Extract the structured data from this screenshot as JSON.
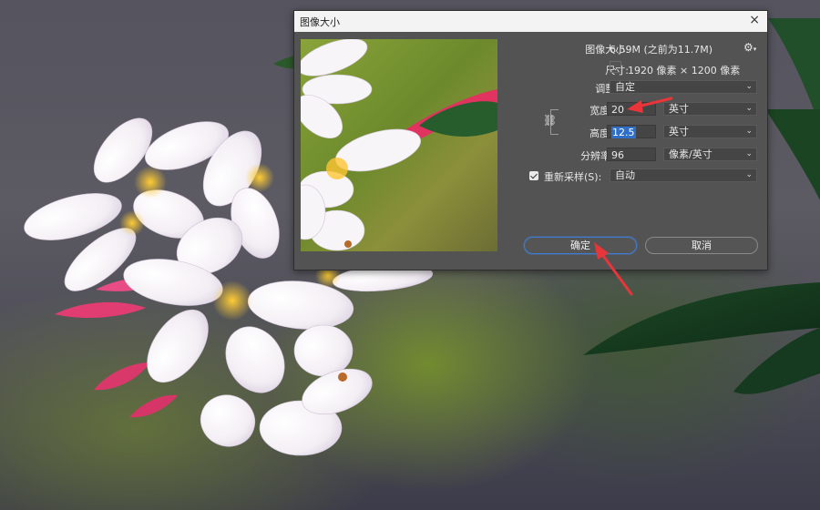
{
  "dialog": {
    "title": "图像大小",
    "close_glyph": "×",
    "image_size_label": "图像大小:",
    "image_size_value": "6.59M (之前为11.7M)",
    "gear_icon": "gear-icon",
    "dimensions_label": "尺寸:",
    "dimensions_value": "1920 像素 × 1200 像素",
    "fit_to_label": "调整为:",
    "fit_to_value": "自定",
    "width_label": "宽度(D):",
    "width_value": "20",
    "width_unit": "英寸",
    "height_label": "高度(G):",
    "height_value": "12.5",
    "height_unit": "英寸",
    "resolution_label": "分辨率(R):",
    "resolution_value": "96",
    "resolution_unit": "像素/英寸",
    "resample_label": "重新采样(S):",
    "resample_checked": true,
    "resample_value": "自动",
    "ok_label": "确定",
    "cancel_label": "取消"
  },
  "colors": {
    "dialog_bg": "#535353",
    "titlebar_bg": "#f3f3f3",
    "annotation_arrow": "#e8353a",
    "primary_button_border": "#3f7bd0",
    "selected_text_bg": "#2f6fc8"
  }
}
